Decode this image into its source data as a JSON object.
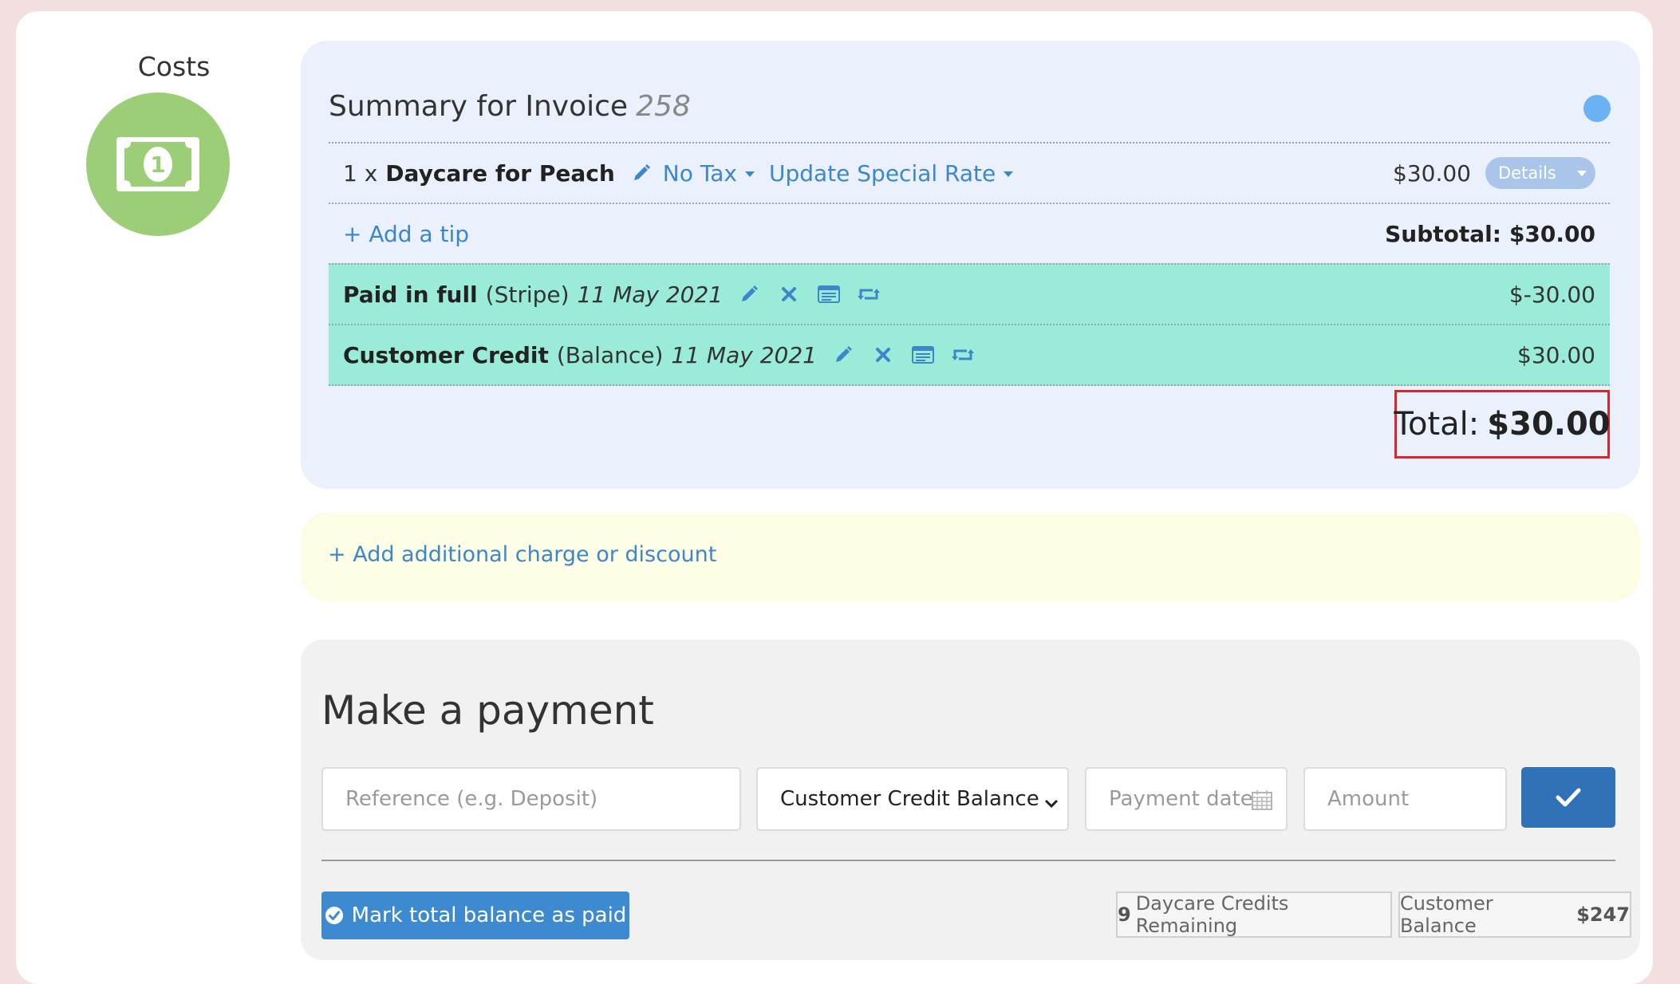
{
  "costs": {
    "title": "Costs",
    "icon": "money-bill-icon",
    "icon_color": "#9ccd77"
  },
  "summary": {
    "title": "Summary for Invoice",
    "invoice_number": "258",
    "status_color": "#6bb2f4",
    "line_item": {
      "qty": "1 x",
      "name": "Daycare for Peach",
      "tax_label": "No Tax",
      "rate_label": "Update Special Rate",
      "amount": "$30.00",
      "details_label": "Details"
    },
    "tip_link": "+ Add a tip",
    "subtotal_label": "Subtotal:",
    "subtotal_value": "$30.00",
    "payments": [
      {
        "title": "Paid in full",
        "method": "(Stripe)",
        "date": "11 May 2021",
        "amount": "$-30.00"
      },
      {
        "title": "Customer Credit",
        "method": "(Balance)",
        "date": "11 May 2021",
        "amount": "$30.00"
      }
    ],
    "total_label": "Total:",
    "total_value": "$30.00",
    "highlight_color": "#d9262a",
    "payment_row_color": "#9aecd9"
  },
  "charge": {
    "link": "+ Add additional charge or discount"
  },
  "payment": {
    "title": "Make a payment",
    "reference_placeholder": "Reference (e.g. Deposit)",
    "method_selected": "Customer Credit Balance",
    "date_placeholder": "Payment date",
    "amount_placeholder": "Amount",
    "mark_paid_label": "Mark total balance as paid",
    "credits_count": "9",
    "credits_label": "Daycare Credits Remaining",
    "balance_label": "Customer Balance",
    "balance_value": "$247",
    "accent_color": "#2f72b7"
  }
}
